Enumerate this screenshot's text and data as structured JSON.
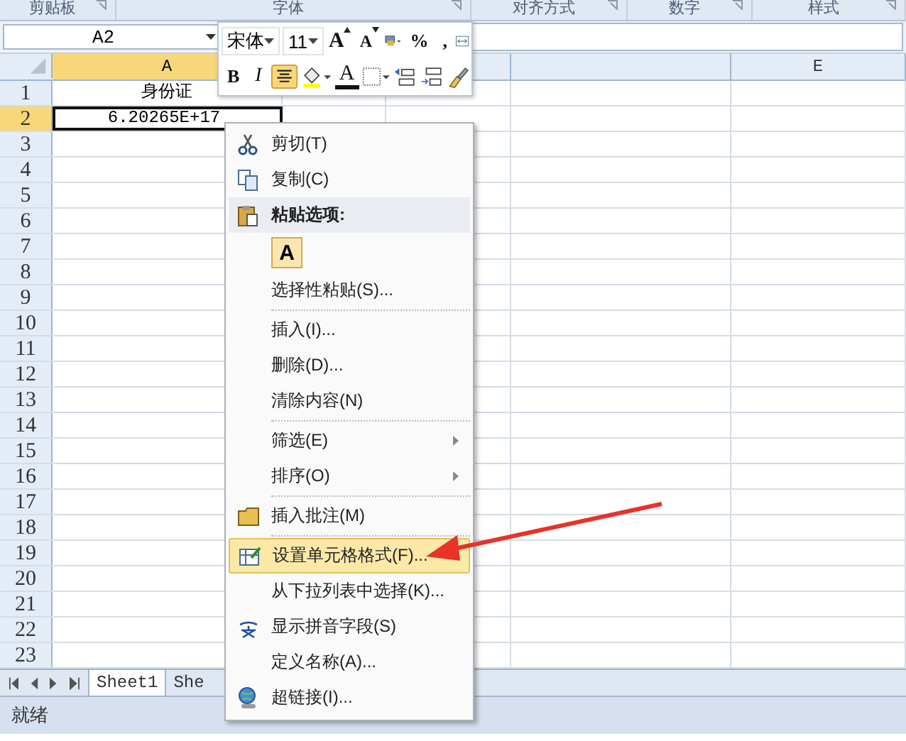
{
  "ribbon_groups": [
    "剪贴板",
    "字体",
    "对齐方式",
    "数字",
    "样式"
  ],
  "name_box": "A2",
  "columns": [
    {
      "label": "A",
      "selected": true
    },
    {
      "label": "E",
      "selected": false
    }
  ],
  "rows": [
    {
      "number": "1",
      "selected": false,
      "cell_a": "身份证"
    },
    {
      "number": "2",
      "selected": true,
      "cell_a": "6.20265E+17"
    },
    {
      "number": "3",
      "selected": false
    },
    {
      "number": "4",
      "selected": false
    },
    {
      "number": "5",
      "selected": false
    },
    {
      "number": "6",
      "selected": false
    },
    {
      "number": "7",
      "selected": false
    },
    {
      "number": "8",
      "selected": false
    },
    {
      "number": "9",
      "selected": false
    },
    {
      "number": "10",
      "selected": false
    },
    {
      "number": "11",
      "selected": false
    },
    {
      "number": "12",
      "selected": false
    },
    {
      "number": "13",
      "selected": false
    },
    {
      "number": "14",
      "selected": false
    },
    {
      "number": "15",
      "selected": false
    },
    {
      "number": "16",
      "selected": false
    },
    {
      "number": "17",
      "selected": false
    },
    {
      "number": "18",
      "selected": false
    },
    {
      "number": "19",
      "selected": false
    },
    {
      "number": "20",
      "selected": false
    },
    {
      "number": "21",
      "selected": false
    },
    {
      "number": "22",
      "selected": false
    },
    {
      "number": "23",
      "selected": false
    }
  ],
  "mini_toolbar": {
    "font": "宋体",
    "size": "11",
    "row_1": [
      {
        "kind": "grow",
        "label": "A"
      },
      {
        "kind": "shrink",
        "label": "A"
      },
      {
        "kind": "currency"
      },
      {
        "kind": "text",
        "label": "%"
      },
      {
        "kind": "text",
        "label": ","
      },
      {
        "kind": "merge"
      }
    ],
    "row_2": [
      {
        "kind": "bold",
        "label": "B",
        "selected": false
      },
      {
        "kind": "italic",
        "label": "I",
        "selected": false
      },
      {
        "kind": "center",
        "selected": true
      },
      {
        "kind": "fill"
      },
      {
        "kind": "fontcolor",
        "label": "A"
      },
      {
        "kind": "borders"
      },
      {
        "kind": "incdec"
      },
      {
        "kind": "decdec"
      },
      {
        "kind": "painter"
      }
    ]
  },
  "context_menu": [
    {
      "kind": "item",
      "label": "剪切(T)",
      "selected": false
    },
    {
      "kind": "item",
      "label": "复制(C)",
      "selected": false
    },
    {
      "kind": "header",
      "label": "粘贴选项:"
    },
    {
      "kind": "paste-option",
      "label": "A"
    },
    {
      "kind": "item",
      "label": "选择性粘贴(S)...",
      "selected": false
    },
    {
      "kind": "separator"
    },
    {
      "kind": "item",
      "label": "插入(I)...",
      "selected": false
    },
    {
      "kind": "item",
      "label": "删除(D)...",
      "selected": false
    },
    {
      "kind": "item",
      "label": "清除内容(N)",
      "selected": false
    },
    {
      "kind": "separator"
    },
    {
      "kind": "item",
      "label": "筛选(E)",
      "submenu": true,
      "selected": false
    },
    {
      "kind": "item",
      "label": "排序(O)",
      "submenu": true,
      "selected": false
    },
    {
      "kind": "separator"
    },
    {
      "kind": "item",
      "label": "插入批注(M)",
      "selected": false
    },
    {
      "kind": "separator"
    },
    {
      "kind": "item",
      "label": "设置单元格格式(F)...",
      "selected": true
    },
    {
      "kind": "item",
      "label": "从下拉列表中选择(K)...",
      "selected": false
    },
    {
      "kind": "item",
      "label": "显示拼音字段(S)",
      "selected": false
    },
    {
      "kind": "item",
      "label": "定义名称(A)...",
      "selected": false
    },
    {
      "kind": "item",
      "label": "超链接(I)...",
      "selected": false
    }
  ],
  "sheet_tabs": [
    {
      "label": "Sheet1",
      "selected": true
    },
    {
      "label": "She",
      "selected": false
    }
  ],
  "status_bar": "就绪"
}
